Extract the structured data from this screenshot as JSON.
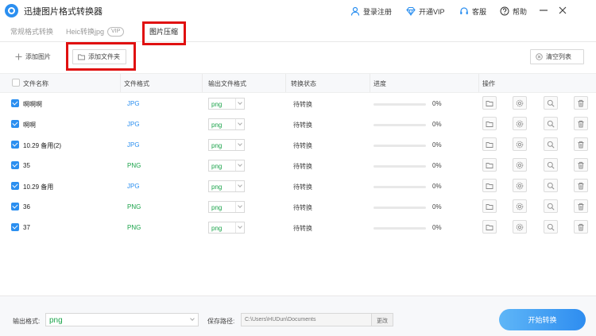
{
  "app": {
    "title": "迅捷图片格式转换器"
  },
  "header": {
    "login": "登录注册",
    "vip": "开通VIP",
    "service": "客服",
    "help": "帮助"
  },
  "tabs": [
    {
      "label": "常规格式转换"
    },
    {
      "label": "Heic转换jpg",
      "badge": "VIP"
    },
    {
      "label": "图片压缩"
    }
  ],
  "toolbar": {
    "add_image": "添加图片",
    "add_folder": "添加文件夹",
    "clear_list": "清空列表"
  },
  "table": {
    "columns": [
      "文件名称",
      "文件格式",
      "输出文件格式",
      "转换状态",
      "进度",
      "操作"
    ],
    "rows": [
      {
        "name": "啊啊啊",
        "format": "JPG",
        "output": "png",
        "status": "待转换",
        "progress": "0%"
      },
      {
        "name": "啊啊",
        "format": "JPG",
        "output": "png",
        "status": "待转换",
        "progress": "0%"
      },
      {
        "name": "10.29 备用(2)",
        "format": "JPG",
        "output": "png",
        "status": "待转换",
        "progress": "0%"
      },
      {
        "name": "35",
        "format": "PNG",
        "output": "png",
        "status": "待转换",
        "progress": "0%"
      },
      {
        "name": "10.29 备用",
        "format": "JPG",
        "output": "png",
        "status": "待转换",
        "progress": "0%"
      },
      {
        "name": "36",
        "format": "PNG",
        "output": "png",
        "status": "待转换",
        "progress": "0%"
      },
      {
        "name": "37",
        "format": "PNG",
        "output": "png",
        "status": "待转换",
        "progress": "0%"
      }
    ]
  },
  "footer": {
    "output_format_label": "输出格式:",
    "output_format_value": "png",
    "save_path_label": "保存路径:",
    "save_path_value": "C:\\Users\\HUDun\\Documents",
    "change": "更改",
    "start": "开始转换"
  },
  "colors": {
    "accent": "#2b8ff0",
    "jpg": "#2b8ff0",
    "png": "#1aa34a",
    "highlight": "#e01010"
  },
  "icons": {
    "row_actions": [
      "folder-icon",
      "settings-icon",
      "preview-icon",
      "delete-icon"
    ]
  }
}
